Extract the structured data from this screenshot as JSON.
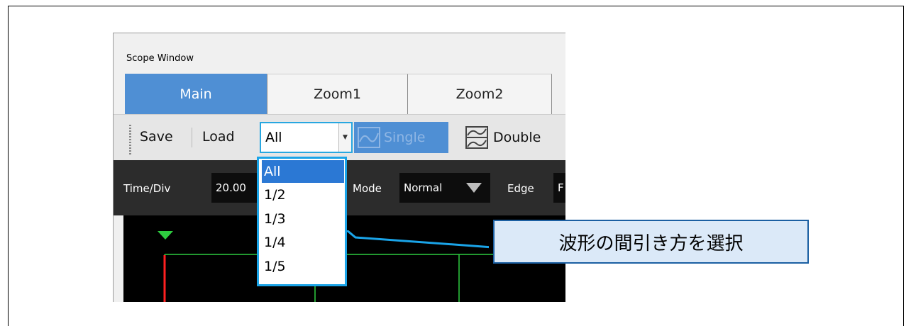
{
  "window": {
    "title": "Scope Window"
  },
  "tabs": [
    {
      "label": "Main",
      "active": true
    },
    {
      "label": "Zoom1",
      "active": false
    },
    {
      "label": "Zoom2",
      "active": false
    }
  ],
  "toolbar": {
    "save_label": "Save",
    "load_label": "Load",
    "decimation_value": "All",
    "single_label": "Single",
    "double_label": "Double"
  },
  "params": {
    "timediv_label": "Time/Div",
    "timediv_value": "20.00",
    "mode_label": "Mode",
    "mode_value": "Normal",
    "edge_label": "Edge",
    "edge_value": "F"
  },
  "dropdown": {
    "options": [
      "All",
      "1/2",
      "1/3",
      "1/4",
      "1/5"
    ],
    "selected": "All"
  },
  "callout": {
    "text": "波形の間引き方を選択"
  },
  "colors": {
    "accent": "#4f8fd4",
    "selection": "#2b78d4",
    "highlight_border": "#1aa4e8",
    "trace_green": "#2ecc40",
    "trace_red": "#ff2020"
  }
}
